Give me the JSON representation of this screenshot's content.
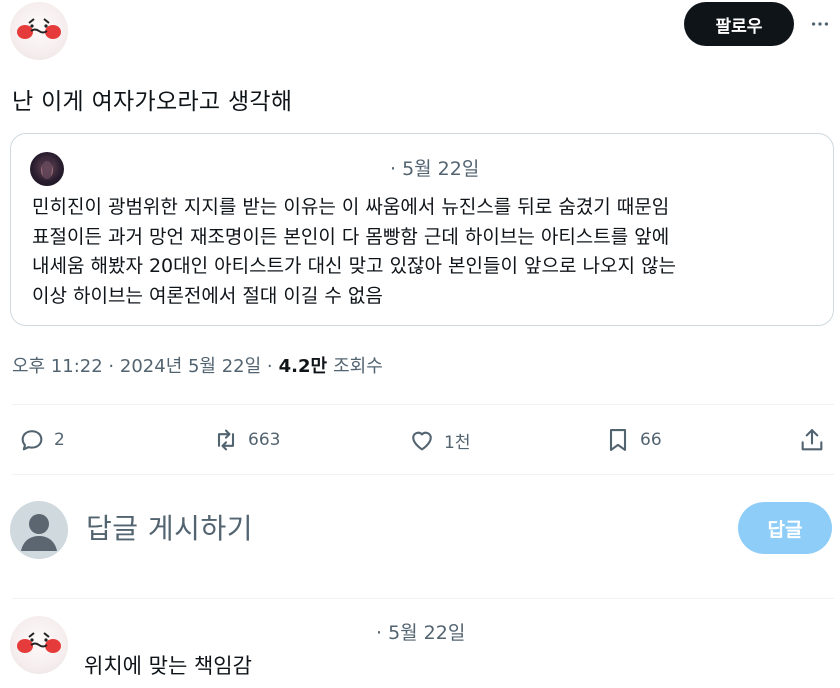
{
  "author": {
    "follow_label": "팔로우",
    "more_icon": "more-horizontal-icon"
  },
  "tweet": {
    "text": "난 이게 여자가오라고 생각해"
  },
  "quote": {
    "date": "· 5월 22일",
    "body": "민히진이 광범위한 지지를 받는 이유는 이 싸움에서 뉴진스를 뒤로 숨겼기 때문임\n표절이든 과거 망언 재조명이든 본인이 다 몸빵함 근데 하이브는 아티스트를 앞에\n내세움 해봤자 20대인 아티스트가 대신 맞고 있잖아 본인들이 앞으로 나오지 않는\n이상 하이브는 여론전에서 절대 이길 수 없음"
  },
  "meta": {
    "time": "오후 11:22 · 2024년 5월 22일 ·",
    "views_count": "4.2만",
    "views_label": "조회수"
  },
  "actions": {
    "replies": "2",
    "retweets": "663",
    "likes": "1천",
    "bookmarks": "66"
  },
  "compose": {
    "placeholder": "답글 게시하기",
    "button_label": "답글"
  },
  "reply": {
    "date": "· 5월 22일",
    "text": "위치에 맞는 책임감"
  },
  "colors": {
    "text_primary": "#0f1419",
    "text_secondary": "#536471",
    "border": "#cfd9de",
    "reply_button": "#8ecdf8"
  }
}
